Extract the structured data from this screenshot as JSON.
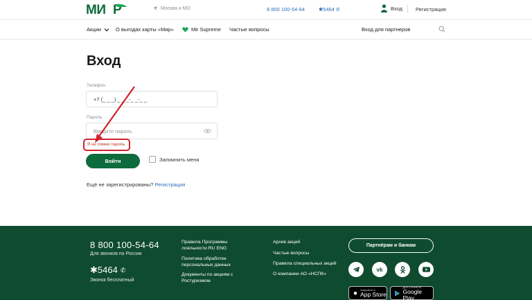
{
  "header": {
    "logo_text": "МИР",
    "location": "Москва и МО",
    "phone": "8 800 100-54-64",
    "short_number": "✱5464",
    "login": "Вход",
    "register": "Регистрация"
  },
  "nav": {
    "items": [
      "Акции",
      "О выгодах карты «Мир»",
      "Mir Supreme",
      "Частые вопросы"
    ],
    "partners_login": "Вход для партнеров"
  },
  "form": {
    "title": "Вход",
    "phone_label": "Телефон",
    "phone_value": "+7 (_ _ _) _ _ _-_ _-_ _",
    "password_label": "Пароль",
    "password_placeholder": "Введите пароль",
    "forgot": "Я не помню пароль",
    "login_button": "Войти",
    "remember_me": "Запомнить меня",
    "not_registered": "Ещё не зарегистрированы?",
    "register_link": "Регистрация"
  },
  "footer": {
    "phone": "8 800 100-54-64",
    "phone_note": "Для звонков по России",
    "short_number": "✱5464",
    "short_note": "Звонок бесплатный",
    "col1": [
      "Правила Программы лояльности RU ENG",
      "Политика обработки персональных данных",
      "Документы по акциям с Ростуризмом"
    ],
    "col2": [
      "Архив акций",
      "Частые вопросы",
      "Правила специальных акций",
      "О компании АО «НСПК»"
    ],
    "partners_button": "Партнёрам и банкам",
    "app_store_small": "Загрузите в",
    "app_store": "App Store",
    "google_play_small": "ДОСТУПНО В",
    "google_play": "Google Play"
  },
  "colors": {
    "brand_green": "#0d6b3c",
    "footer_green": "#0f4b2f",
    "link_blue": "#2d6fb6",
    "annotation_red": "#d0222d"
  }
}
